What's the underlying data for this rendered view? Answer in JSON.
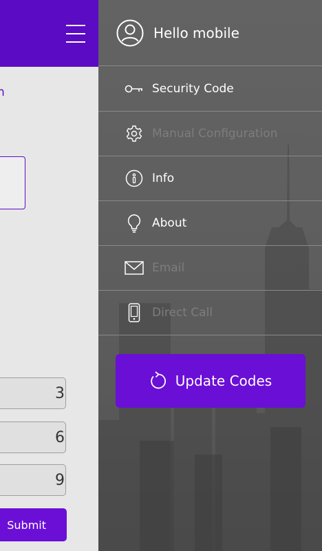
{
  "left_screen": {
    "peek_text": "n",
    "keys": [
      "3",
      "6",
      "9"
    ],
    "submit_label": "Submit"
  },
  "drawer": {
    "greeting": "Hello mobile",
    "items": [
      {
        "label": "Security Code",
        "icon": "key-icon",
        "enabled": true
      },
      {
        "label": "Manual Configuration",
        "icon": "gear-icon",
        "enabled": false
      },
      {
        "label": "Info",
        "icon": "info-icon",
        "enabled": true
      },
      {
        "label": "About",
        "icon": "lightbulb-icon",
        "enabled": true
      },
      {
        "label": "Email",
        "icon": "envelope-icon",
        "enabled": false
      },
      {
        "label": "Direct Call",
        "icon": "phone-icon",
        "enabled": false
      }
    ],
    "update_button_label": "Update Codes"
  },
  "colors": {
    "brand_purple": "#5b0bc4",
    "button_purple": "#6a0fd6",
    "disabled_text": "#7d7d7d"
  }
}
